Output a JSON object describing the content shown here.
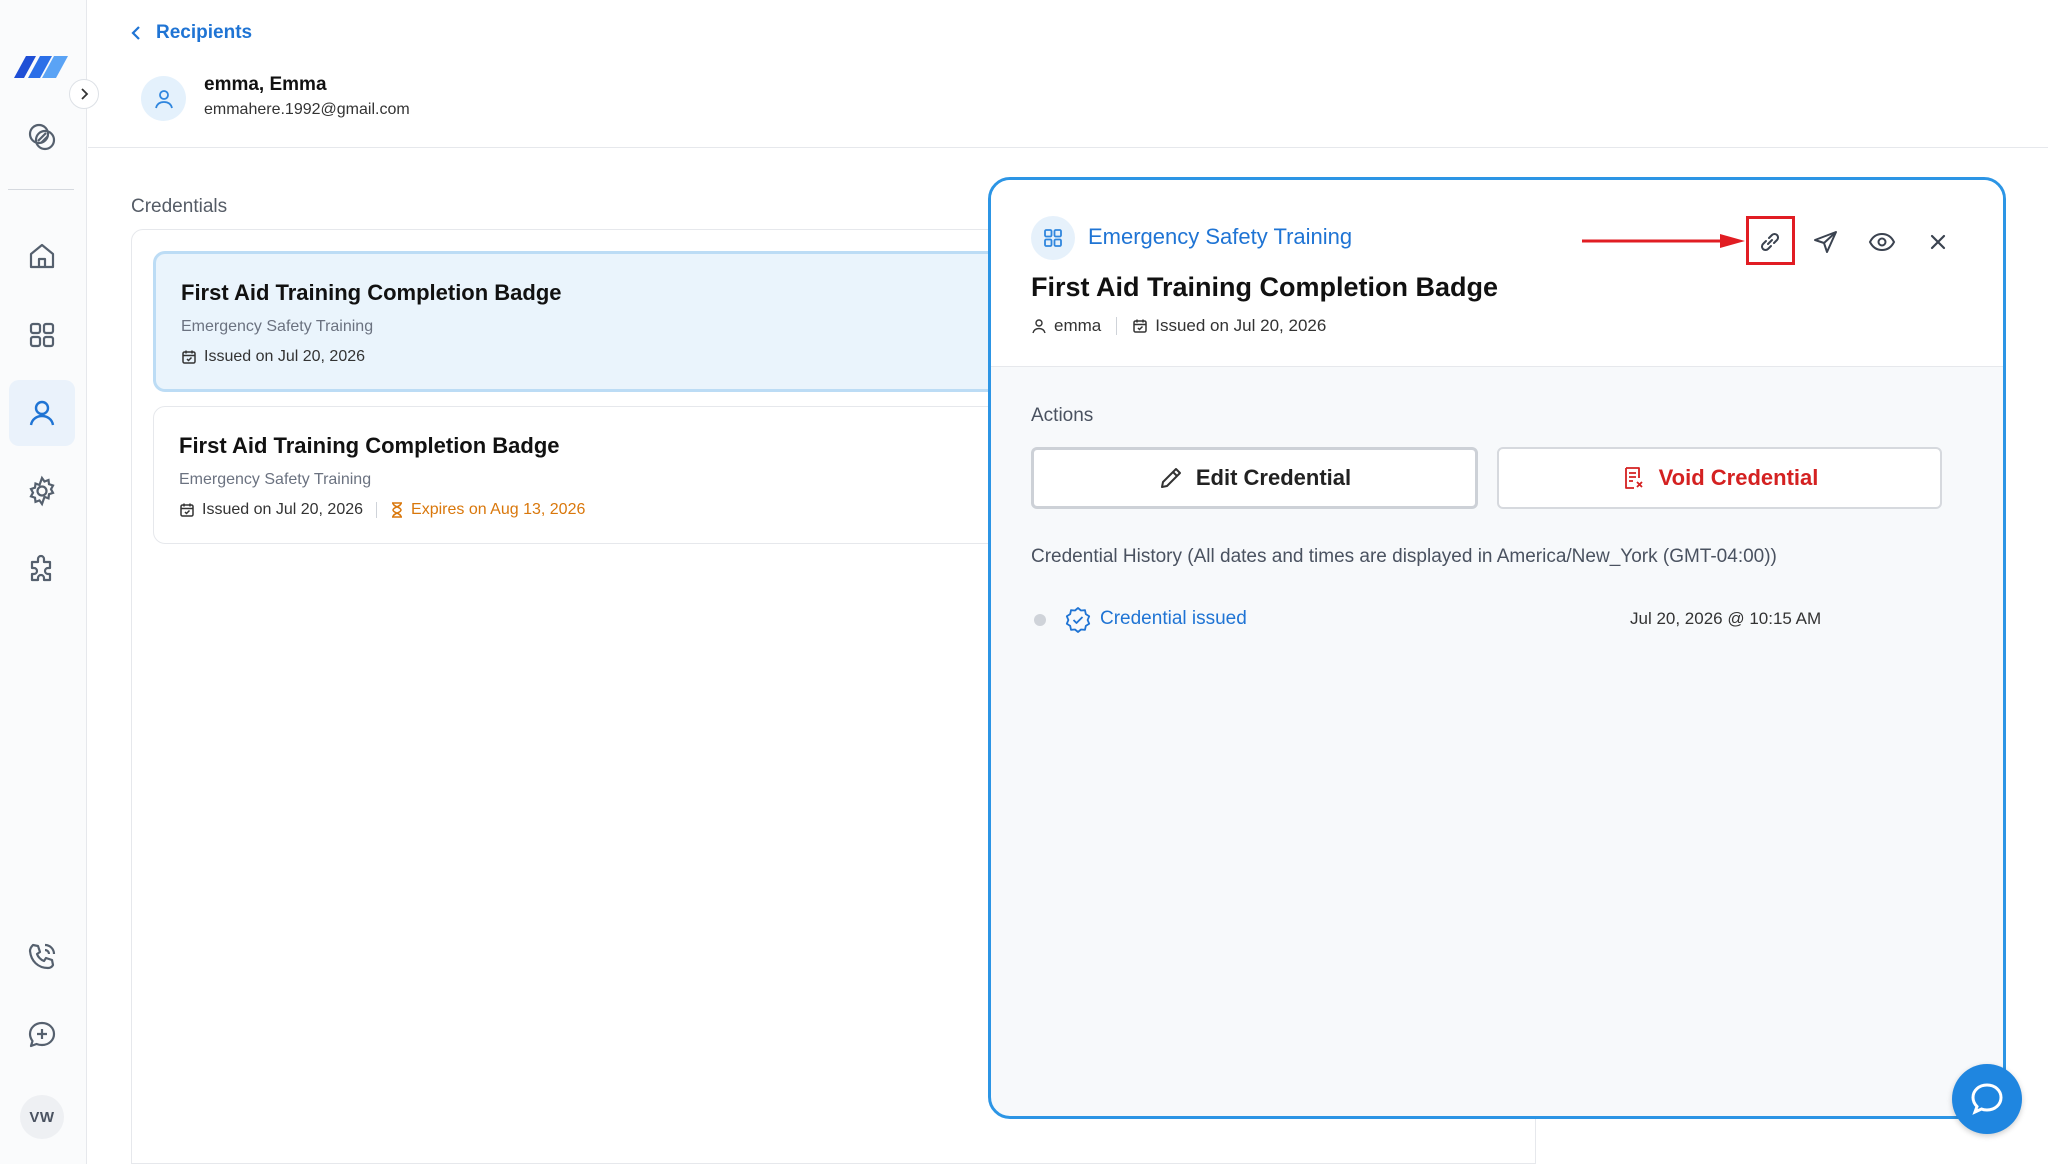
{
  "breadcrumb": {
    "label": "Recipients"
  },
  "recipient": {
    "name": "emma, Emma",
    "email": "emmahere.1992@gmail.com"
  },
  "credentials": {
    "section_label": "Credentials",
    "items": [
      {
        "title": "First Aid Training Completion Badge",
        "group": "Emergency Safety Training",
        "issued": "Issued on Jul 20, 2026",
        "expires": ""
      },
      {
        "title": "First Aid Training Completion Badge",
        "group": "Emergency Safety Training",
        "issued": "Issued on Jul 20, 2026",
        "expires": "Expires on Aug 13, 2026"
      }
    ]
  },
  "drawer": {
    "group": "Emergency Safety Training",
    "title": "First Aid Training Completion Badge",
    "recipient": "emma",
    "issued": "Issued on Jul 20, 2026",
    "actions_label": "Actions",
    "edit_label": "Edit Credential",
    "void_label": "Void Credential",
    "history_label": "Credential History (All dates and times are displayed in America/New_York (GMT-04:00))",
    "history": [
      {
        "event": "Credential issued",
        "date": "Jul 20, 2026 @ 10:15 AM"
      }
    ],
    "toolbar_icons": [
      "link-icon",
      "send-icon",
      "eye-icon",
      "close-icon"
    ]
  },
  "sidebar": {
    "icons": [
      "logo",
      "chevron-right-icon",
      "overlap-circles-icon",
      "home-icon",
      "grid-icon",
      "user-icon",
      "gear-icon",
      "puzzle-icon",
      "phone-icon",
      "chat-plus-icon"
    ],
    "avatar_initials": "VW"
  },
  "colors": {
    "accent": "#1f74d4",
    "danger": "#d42121",
    "warning": "#d9770b",
    "highlight": "#e11d23"
  }
}
